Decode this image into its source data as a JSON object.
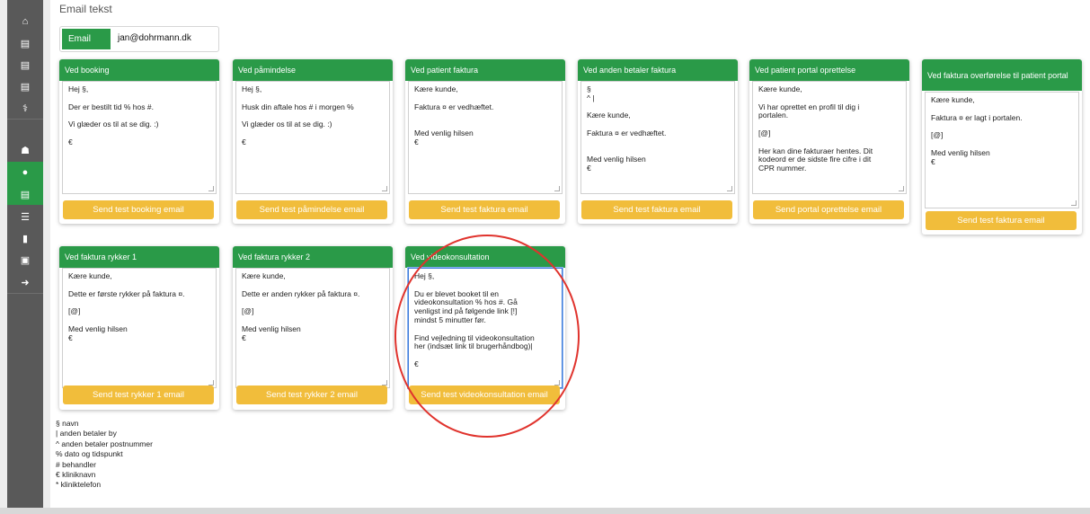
{
  "page": {
    "title": "Email tekst"
  },
  "email": {
    "label": "Email",
    "value": "jan@dohrmann.dk"
  },
  "sidebar": [
    {
      "icon": "⌂",
      "name": "home-icon",
      "active": false
    },
    {
      "icon": "▤",
      "name": "clipboard-icon",
      "active": false
    },
    {
      "icon": "▤",
      "name": "clipboard-icon",
      "active": false
    },
    {
      "icon": "▤",
      "name": "clipboard-icon",
      "active": false
    },
    {
      "icon": "⚕",
      "name": "caduceus-icon",
      "active": false
    },
    {
      "icon": "☗",
      "name": "users-icon",
      "active": false
    },
    {
      "icon": "●",
      "name": "chat-icon",
      "active": true
    },
    {
      "icon": "▤",
      "name": "clipboard-icon",
      "active": true
    },
    {
      "icon": "☰",
      "name": "list-icon",
      "active": false
    },
    {
      "icon": "▮",
      "name": "file-icon",
      "active": false
    },
    {
      "icon": "▣",
      "name": "archive-icon",
      "active": false
    },
    {
      "icon": "➜",
      "name": "sign-out-icon",
      "active": false
    }
  ],
  "cards": [
    {
      "title": "Ved booking",
      "lines": [
        "Hej §,",
        "",
        "Der er bestilt tid % hos #.",
        "",
        "Vi glæder os til at se dig. :)",
        "",
        "€"
      ],
      "button": "Send test booking email"
    },
    {
      "title": "Ved påmindelse",
      "lines": [
        "Hej §,",
        "",
        "Husk din aftale hos # i morgen %",
        "",
        "Vi glæder os til at se dig. :)",
        "",
        "€"
      ],
      "button": "Send test påmindelse email"
    },
    {
      "title": "Ved patient faktura",
      "lines": [
        "Kære kunde,",
        "",
        "Faktura ¤ er vedhæftet.",
        "",
        "",
        "Med venlig hilsen",
        "€"
      ],
      "button": "Send test faktura email"
    },
    {
      "title": "Ved anden betaler faktura",
      "lines": [
        "§",
        "^ |",
        "",
        "Kære kunde,",
        "",
        "Faktura ¤ er vedhæftet.",
        "",
        "",
        "Med venlig hilsen",
        "€"
      ],
      "button": "Send test faktura email"
    },
    {
      "title": "Ved patient portal oprettelse",
      "lines": [
        "Kære kunde,",
        "",
        "Vi har oprettet en profil til dig i",
        "portalen.",
        "",
        "[@]",
        "",
        "Her kan dine fakturaer hentes. Dit",
        "kodeord er de sidste fire cifre i dit",
        "CPR nummer."
      ],
      "button": "Send portal oprettelse email"
    },
    {
      "title": "Ved faktura overførelse til patient portal",
      "lines": [
        "Kære kunde,",
        "",
        "Faktura ¤ er lagt i portalen.",
        "",
        "[@]",
        "",
        "Med venlig hilsen",
        "€"
      ],
      "button": "Send test faktura email"
    },
    {
      "title": "Ved faktura rykker 1",
      "lines": [
        "Kære kunde,",
        "",
        "Dette er første rykker på faktura ¤.",
        "",
        "[@]",
        "",
        "Med venlig hilsen",
        "€"
      ],
      "button": "Send test rykker 1 email"
    },
    {
      "title": "Ved faktura rykker 2",
      "lines": [
        "Kære kunde,",
        "",
        "Dette er anden rykker på faktura ¤.",
        "",
        "[@]",
        "",
        "Med venlig hilsen",
        "€"
      ],
      "button": "Send test rykker 2 email"
    },
    {
      "title": "Ved videokonsultation",
      "lines": [
        "Hej §,",
        "",
        "Du er blevet booket til en",
        "videokonsultation % hos #. Gå",
        "venligst ind på følgende link [!]",
        "mindst 5 minutter før.",
        "",
        "Find vejledning til videokonsultation",
        "her (indsæt link til brugerhåndbog)|",
        "",
        "€"
      ],
      "button": "Send test videokonsultation email"
    }
  ],
  "legend": [
    "§ navn",
    "| anden betaler by",
    "^ anden betaler postnummer",
    "% dato og tidspunkt",
    "# behandler",
    "€ kliniknavn",
    "* kliniktelefon"
  ],
  "colors": {
    "accent": "#2a9a48",
    "button": "#f1bd3b",
    "sidebar": "#595959",
    "highlight": "#e0332d"
  }
}
